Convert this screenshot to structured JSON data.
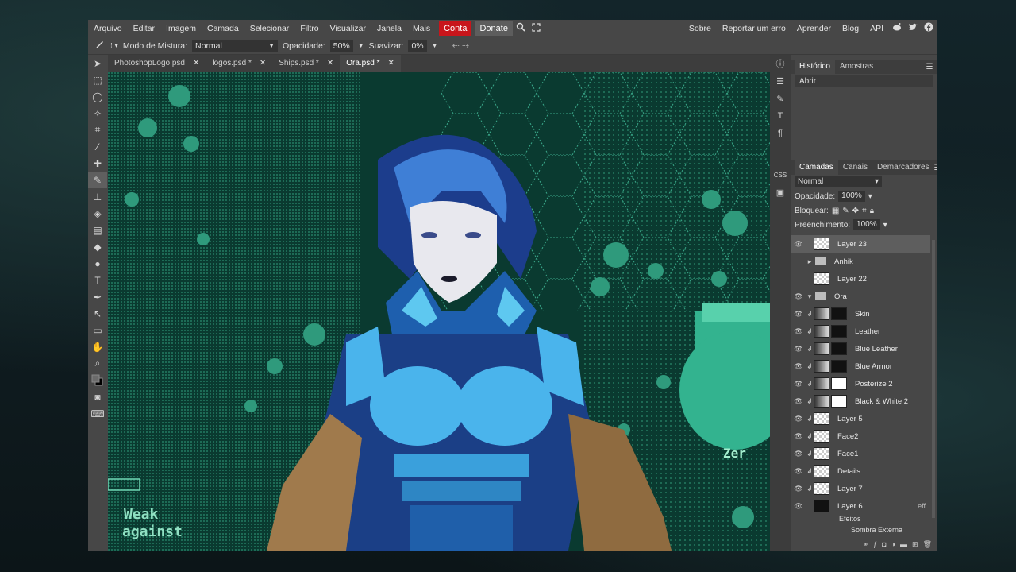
{
  "menu": {
    "items": [
      "Arquivo",
      "Editar",
      "Imagem",
      "Camada",
      "Selecionar",
      "Filtro",
      "Visualizar",
      "Janela",
      "Mais"
    ],
    "conta": "Conta",
    "donate": "Donate",
    "right_items": [
      "Sobre",
      "Reportar um erro",
      "Aprender",
      "Blog",
      "API"
    ]
  },
  "options": {
    "blend_label": "Modo de Mistura:",
    "blend_value": "Normal",
    "opacity_label": "Opacidade:",
    "opacity_value": "50%",
    "smooth_label": "Suavizar:",
    "smooth_value": "0%"
  },
  "tabs": [
    {
      "label": "PhotoshopLogo.psd",
      "active": false
    },
    {
      "label": "logos.psd *",
      "active": false
    },
    {
      "label": "Ships.psd *",
      "active": false
    },
    {
      "label": "Ora.psd *",
      "active": true
    }
  ],
  "history": {
    "tab_history": "Histórico",
    "tab_samples": "Amostras",
    "entries": [
      "Abrir"
    ]
  },
  "layers": {
    "tab_layers": "Camadas",
    "tab_channels": "Canais",
    "tab_markers": "Demarcadores",
    "blend": "Normal",
    "opacity_label": "Opacidade:",
    "opacity_value": "100%",
    "lock_label": "Bloquear:",
    "fill_label": "Preenchimento:",
    "fill_value": "100%",
    "rows": [
      {
        "name": "Layer 23",
        "kind": "layer",
        "selected": true
      },
      {
        "name": "Anhik",
        "kind": "folder"
      },
      {
        "name": "Layer 22",
        "kind": "layer"
      },
      {
        "name": "Ora",
        "kind": "folder-open"
      },
      {
        "name": "Skin",
        "kind": "adj"
      },
      {
        "name": "Leather",
        "kind": "adj"
      },
      {
        "name": "Blue Leather",
        "kind": "adj"
      },
      {
        "name": "Blue Armor",
        "kind": "adj"
      },
      {
        "name": "Posterize 2",
        "kind": "adj-white"
      },
      {
        "name": "Black & White 2",
        "kind": "adj-white"
      },
      {
        "name": "Layer 5",
        "kind": "clip"
      },
      {
        "name": "Face2",
        "kind": "clip"
      },
      {
        "name": "Face1",
        "kind": "clip"
      },
      {
        "name": "Details",
        "kind": "clip"
      },
      {
        "name": "Layer 7",
        "kind": "clip"
      },
      {
        "name": "Layer 6",
        "kind": "effect"
      }
    ],
    "effects_label": "Efeitos",
    "effect_name": "Sombra Externa",
    "eff_badge": "eff"
  },
  "canvas_text": [
    "Weak",
    "against",
    "Zer"
  ],
  "colors": {
    "canvas_bg": "#0a3a30",
    "accent_red": "#c8151b"
  }
}
